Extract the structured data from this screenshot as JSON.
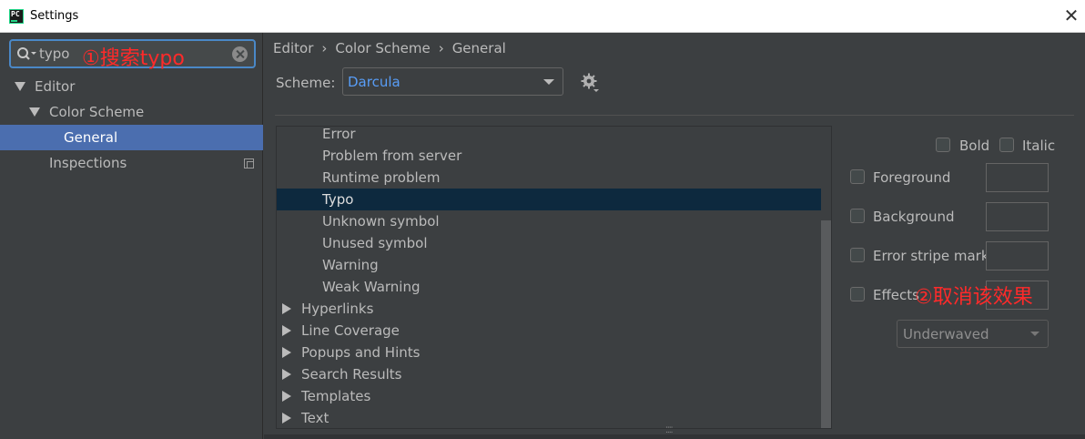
{
  "window": {
    "title": "Settings",
    "app_icon_text": "PC",
    "close_glyph": "✕"
  },
  "search": {
    "value": "typo",
    "annotation": "①搜索typo"
  },
  "tree": [
    {
      "label": "Editor"
    },
    {
      "label": "Color Scheme"
    },
    {
      "label": "General"
    },
    {
      "label": "Inspections"
    }
  ],
  "breadcrumb": [
    "Editor",
    "Color Scheme",
    "General"
  ],
  "breadcrumb_sep": "›",
  "scheme": {
    "label": "Scheme:",
    "value": "Darcula"
  },
  "list": {
    "items": [
      {
        "label": "Error",
        "type": "child"
      },
      {
        "label": "Problem from server",
        "type": "child"
      },
      {
        "label": "Runtime problem",
        "type": "child"
      },
      {
        "label": "Typo",
        "type": "child",
        "selected": true
      },
      {
        "label": "Unknown symbol",
        "type": "child"
      },
      {
        "label": "Unused symbol",
        "type": "child"
      },
      {
        "label": "Warning",
        "type": "child"
      },
      {
        "label": "Weak Warning",
        "type": "child"
      },
      {
        "label": "Hyperlinks",
        "type": "group"
      },
      {
        "label": "Line Coverage",
        "type": "group"
      },
      {
        "label": "Popups and Hints",
        "type": "group"
      },
      {
        "label": "Search Results",
        "type": "group"
      },
      {
        "label": "Templates",
        "type": "group"
      },
      {
        "label": "Text",
        "type": "group"
      }
    ]
  },
  "options": {
    "bold": "Bold",
    "italic": "Italic",
    "foreground": "Foreground",
    "background": "Background",
    "error_stripe": "Error stripe mark",
    "effects": "Effects",
    "effects_annotation": "②取消该效果",
    "effect_type": "Underwaved"
  },
  "colors": {
    "accent": "#4b6eaf",
    "selection": "#0d293e",
    "scheme_value": "#589df6",
    "annotation": "#ff2a2a"
  }
}
